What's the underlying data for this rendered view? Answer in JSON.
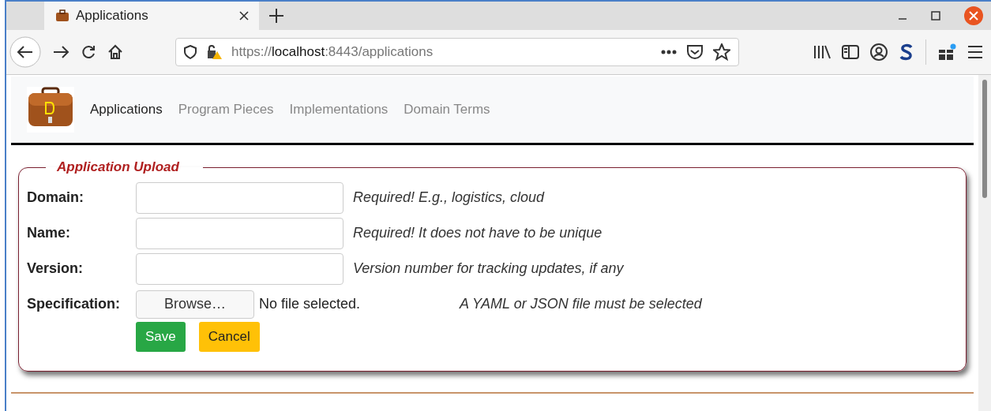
{
  "browser": {
    "tab": {
      "title": "Applications",
      "selected": true
    },
    "url": {
      "scheme": "https://",
      "host": "localhost",
      "rest": ":8443/applications"
    }
  },
  "nav": [
    {
      "label": "Applications",
      "selected": true
    },
    {
      "label": "Program Pieces",
      "selected": false
    },
    {
      "label": "Implementations",
      "selected": false
    },
    {
      "label": "Domain Terms",
      "selected": false
    }
  ],
  "form": {
    "legend": "Application Upload",
    "fields": [
      {
        "kind": "text",
        "label": "Domain:",
        "hint": "Required! E.g., logistics, cloud"
      },
      {
        "kind": "text",
        "label": "Name:",
        "hint": "Required! It does not have to be unique"
      },
      {
        "kind": "text",
        "label": "Version:",
        "hint": "Version number for tracking updates, if any"
      },
      {
        "kind": "file",
        "label": "Specification:",
        "button": "Browse…",
        "status": "No file selected.",
        "hint": "A YAML or JSON file must be selected"
      }
    ],
    "buttons": [
      {
        "kind": "save",
        "label": "Save"
      },
      {
        "kind": "cancel",
        "label": "Cancel"
      }
    ]
  }
}
